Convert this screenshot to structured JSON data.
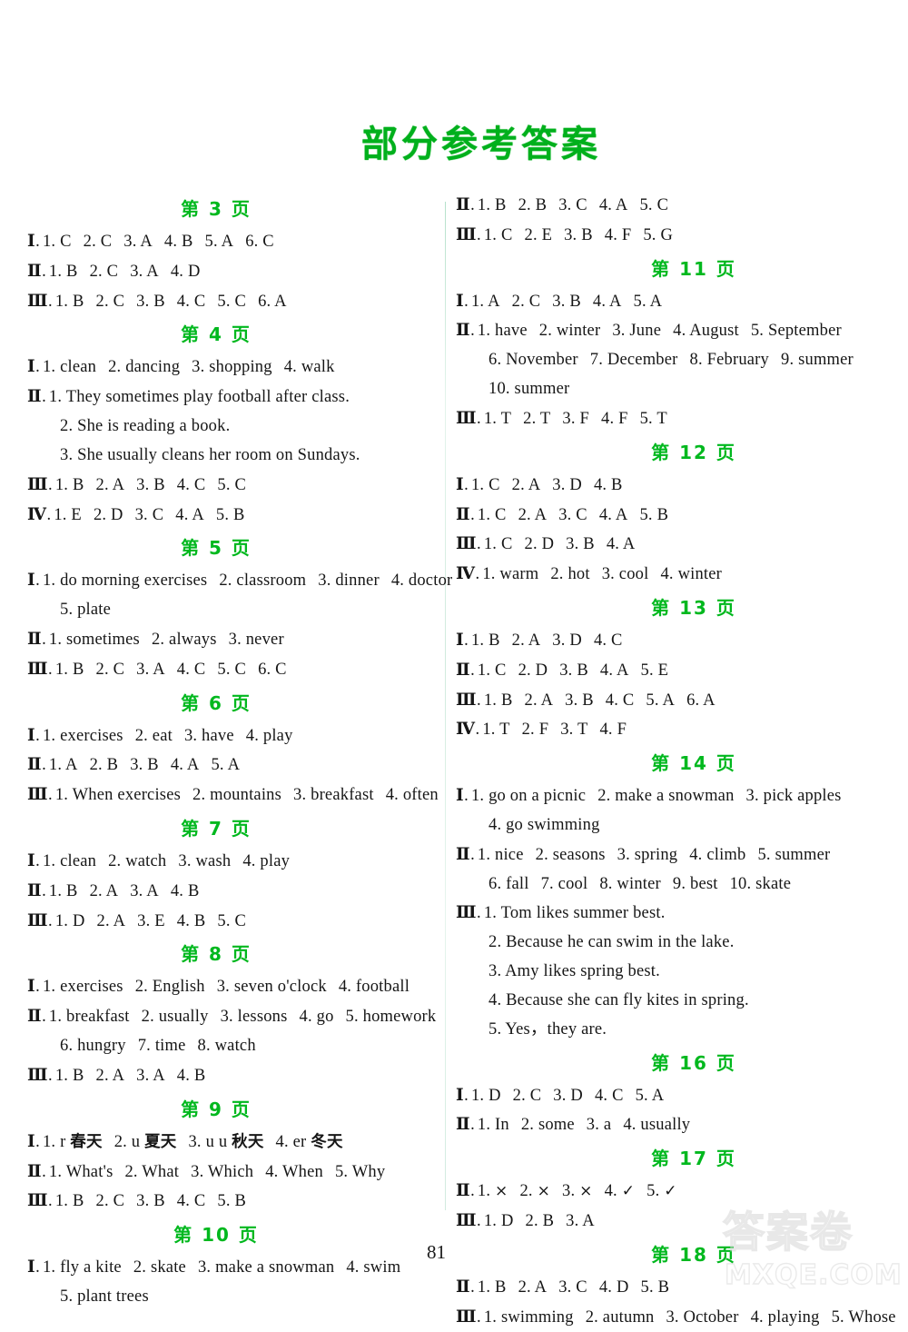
{
  "document": {
    "title": "部分参考答案",
    "folio": "81",
    "title_color": "#00b01c",
    "heading_color": "#00b81e"
  },
  "watermark": {
    "chinese": "答案卷",
    "url": "MXQE.COM"
  },
  "left_column": [
    {
      "heading": "第 3 页",
      "blocks": [
        {
          "roman": "Ⅰ",
          "indent": false,
          "items": [
            "1. C",
            "2. C",
            "3. A",
            "4. B",
            "5. A",
            "6. C"
          ]
        },
        {
          "roman": "Ⅱ",
          "indent": false,
          "items": [
            "1. B",
            "2. C",
            "3. A",
            "4. D"
          ]
        },
        {
          "roman": "Ⅲ",
          "indent": false,
          "items": [
            "1. B",
            "2. C",
            "3. B",
            "4. C",
            "5. C",
            "6. A"
          ]
        }
      ]
    },
    {
      "heading": "第 4 页",
      "blocks": [
        {
          "roman": "Ⅰ",
          "indent": false,
          "items": [
            "1. clean",
            "2. dancing",
            "3. shopping",
            "4. walk"
          ]
        },
        {
          "roman": "Ⅱ",
          "indent": false,
          "items": [
            "1. They sometimes play football after class."
          ]
        },
        {
          "roman": "",
          "indent": true,
          "items": [
            "2. She is reading a book."
          ]
        },
        {
          "roman": "",
          "indent": true,
          "items": [
            "3. She usually cleans her room on Sundays."
          ]
        },
        {
          "roman": "Ⅲ",
          "indent": false,
          "items": [
            "1. B",
            "2. A",
            "3. B",
            "4. C",
            "5. C"
          ]
        },
        {
          "roman": "Ⅳ",
          "indent": false,
          "items": [
            "1. E",
            "2. D",
            "3. C",
            "4. A",
            "5. B"
          ]
        }
      ]
    },
    {
      "heading": "第 5 页",
      "blocks": [
        {
          "roman": "Ⅰ",
          "indent": false,
          "items": [
            "1. do morning exercises",
            "2. classroom",
            "3. dinner",
            "4. doctor"
          ]
        },
        {
          "roman": "",
          "indent": true,
          "items": [
            "5. plate"
          ]
        },
        {
          "roman": "Ⅱ",
          "indent": false,
          "items": [
            "1. sometimes",
            "2. always",
            "3. never"
          ]
        },
        {
          "roman": "Ⅲ",
          "indent": false,
          "items": [
            "1. B",
            "2. C",
            "3. A",
            "4. C",
            "5. C",
            "6. C"
          ]
        }
      ]
    },
    {
      "heading": "第 6 页",
      "blocks": [
        {
          "roman": "Ⅰ",
          "indent": false,
          "items": [
            "1. exercises",
            "2. eat",
            "3. have",
            "4. play"
          ]
        },
        {
          "roman": "Ⅱ",
          "indent": false,
          "items": [
            "1. A",
            "2. B",
            "3. B",
            "4. A",
            "5. A"
          ]
        },
        {
          "roman": "Ⅲ",
          "indent": false,
          "items": [
            "1. When   exercises",
            "2. mountains",
            "3. breakfast",
            "4. often"
          ]
        }
      ]
    },
    {
      "heading": "第 7 页",
      "blocks": [
        {
          "roman": "Ⅰ",
          "indent": false,
          "items": [
            "1. clean",
            "2. watch",
            "3. wash",
            "4. play"
          ]
        },
        {
          "roman": "Ⅱ",
          "indent": false,
          "items": [
            "1. B",
            "2. A",
            "3. A",
            "4. B"
          ]
        },
        {
          "roman": "Ⅲ",
          "indent": false,
          "items": [
            "1. D",
            "2. A",
            "3. E",
            "4. B",
            "5. C"
          ]
        }
      ]
    },
    {
      "heading": "第 8 页",
      "blocks": [
        {
          "roman": "Ⅰ",
          "indent": false,
          "items": [
            "1. exercises",
            "2. English",
            "3. seven o'clock",
            "4. football"
          ]
        },
        {
          "roman": "Ⅱ",
          "indent": false,
          "items": [
            "1. breakfast",
            "2. usually",
            "3. lessons",
            "4. go",
            "5. homework"
          ]
        },
        {
          "roman": "",
          "indent": true,
          "items": [
            "6. hungry",
            "7. time",
            "8. watch"
          ]
        },
        {
          "roman": "Ⅲ",
          "indent": false,
          "items": [
            "1. B",
            "2. A",
            "3. A",
            "4. B"
          ]
        }
      ]
    },
    {
      "heading": "第 9 页",
      "blocks": [
        {
          "roman": "Ⅰ",
          "indent": false,
          "items": [
            "1. r   春天",
            "2. u   夏天",
            "3. u u   秋天",
            "4. er   冬天"
          ]
        },
        {
          "roman": "Ⅱ",
          "indent": false,
          "items": [
            "1. What's",
            "2. What",
            "3. Which",
            "4. When",
            "5. Why"
          ]
        },
        {
          "roman": "Ⅲ",
          "indent": false,
          "items": [
            "1. B",
            "2. C",
            "3. B",
            "4. C",
            "5. B"
          ]
        }
      ]
    },
    {
      "heading": "第 10 页",
      "blocks": [
        {
          "roman": "Ⅰ",
          "indent": false,
          "items": [
            "1. fly a kite",
            "2. skate",
            "3. make a snowman",
            "4. swim"
          ]
        },
        {
          "roman": "",
          "indent": true,
          "items": [
            "5. plant trees"
          ]
        }
      ]
    }
  ],
  "right_column": [
    {
      "heading": "",
      "blocks": [
        {
          "roman": "Ⅱ",
          "indent": false,
          "items": [
            "1. B",
            "2. B",
            "3. C",
            "4. A",
            "5. C"
          ]
        },
        {
          "roman": "Ⅲ",
          "indent": false,
          "items": [
            "1. C",
            "2. E",
            "3. B",
            "4. F",
            "5. G"
          ]
        }
      ]
    },
    {
      "heading": "第 11 页",
      "blocks": [
        {
          "roman": "Ⅰ",
          "indent": false,
          "items": [
            "1. A",
            "2. C",
            "3. B",
            "4. A",
            "5. A"
          ]
        },
        {
          "roman": "Ⅱ",
          "indent": false,
          "items": [
            "1. have",
            "2. winter",
            "3. June",
            "4. August",
            "5. September"
          ]
        },
        {
          "roman": "",
          "indent": true,
          "items": [
            "6. November",
            "7. December",
            "8. February",
            "9. summer"
          ]
        },
        {
          "roman": "",
          "indent": true,
          "items": [
            "10. summer"
          ]
        },
        {
          "roman": "Ⅲ",
          "indent": false,
          "items": [
            "1. T",
            "2. T",
            "3. F",
            "4. F",
            "5. T"
          ]
        }
      ]
    },
    {
      "heading": "第 12 页",
      "blocks": [
        {
          "roman": "Ⅰ",
          "indent": false,
          "items": [
            "1. C",
            "2. A",
            "3. D",
            "4. B"
          ]
        },
        {
          "roman": "Ⅱ",
          "indent": false,
          "items": [
            "1. C",
            "2. A",
            "3. C",
            "4. A",
            "5. B"
          ]
        },
        {
          "roman": "Ⅲ",
          "indent": false,
          "items": [
            "1. C",
            "2. D",
            "3. B",
            "4. A"
          ]
        },
        {
          "roman": "Ⅳ",
          "indent": false,
          "items": [
            "1. warm",
            "2. hot",
            "3. cool",
            "4. winter"
          ]
        }
      ]
    },
    {
      "heading": "第 13 页",
      "blocks": [
        {
          "roman": "Ⅰ",
          "indent": false,
          "items": [
            "1. B",
            "2. A",
            "3. D",
            "4. C"
          ]
        },
        {
          "roman": "Ⅱ",
          "indent": false,
          "items": [
            "1. C",
            "2. D",
            "3. B",
            "4. A",
            "5. E"
          ]
        },
        {
          "roman": "Ⅲ",
          "indent": false,
          "items": [
            "1. B",
            "2. A",
            "3. B",
            "4. C",
            "5. A",
            "6. A"
          ]
        },
        {
          "roman": "Ⅳ",
          "indent": false,
          "items": [
            "1. T",
            "2. F",
            "3. T",
            "4. F"
          ]
        }
      ]
    },
    {
      "heading": "第 14 页",
      "blocks": [
        {
          "roman": "Ⅰ",
          "indent": false,
          "items": [
            "1. go on a picnic",
            "2. make a snowman",
            "3. pick apples"
          ]
        },
        {
          "roman": "",
          "indent": true,
          "items": [
            "4. go swimming"
          ]
        },
        {
          "roman": "Ⅱ",
          "indent": false,
          "items": [
            "1. nice",
            "2. seasons",
            "3. spring",
            "4. climb",
            "5. summer"
          ]
        },
        {
          "roman": "",
          "indent": true,
          "items": [
            "6. fall",
            "7. cool",
            "8. winter",
            "9. best",
            "10. skate"
          ]
        },
        {
          "roman": "Ⅲ",
          "indent": false,
          "items": [
            "1. Tom likes summer best."
          ]
        },
        {
          "roman": "",
          "indent": true,
          "items": [
            "2. Because he can swim in the lake."
          ]
        },
        {
          "roman": "",
          "indent": true,
          "items": [
            "3. Amy likes spring best."
          ]
        },
        {
          "roman": "",
          "indent": true,
          "items": [
            "4. Because she can fly kites in spring."
          ]
        },
        {
          "roman": "",
          "indent": true,
          "items": [
            "5. Yes，they are."
          ]
        }
      ]
    },
    {
      "heading": "第 16 页",
      "blocks": [
        {
          "roman": "Ⅰ",
          "indent": false,
          "items": [
            "1. D",
            "2. C",
            "3. D",
            "4. C",
            "5. A"
          ]
        },
        {
          "roman": "Ⅱ",
          "indent": false,
          "items": [
            "1. In",
            "2. some",
            "3. a",
            "4. usually"
          ]
        }
      ]
    },
    {
      "heading": "第 17 页",
      "blocks": [
        {
          "roman": "Ⅱ",
          "indent": false,
          "items": [
            "1. ×",
            "2. ×",
            "3. ×",
            "4. ✓",
            "5. ✓"
          ]
        },
        {
          "roman": "Ⅲ",
          "indent": false,
          "items": [
            "1. D",
            "2. B",
            "3. A"
          ]
        }
      ]
    },
    {
      "heading": "第 18 页",
      "blocks": [
        {
          "roman": "Ⅱ",
          "indent": false,
          "items": [
            "1. B",
            "2. A",
            "3. C",
            "4. D",
            "5. B"
          ]
        },
        {
          "roman": "Ⅲ",
          "indent": false,
          "items": [
            "1. swimming",
            "2. autumn",
            "3. October",
            "4. playing",
            "5. Whose"
          ]
        }
      ]
    }
  ]
}
